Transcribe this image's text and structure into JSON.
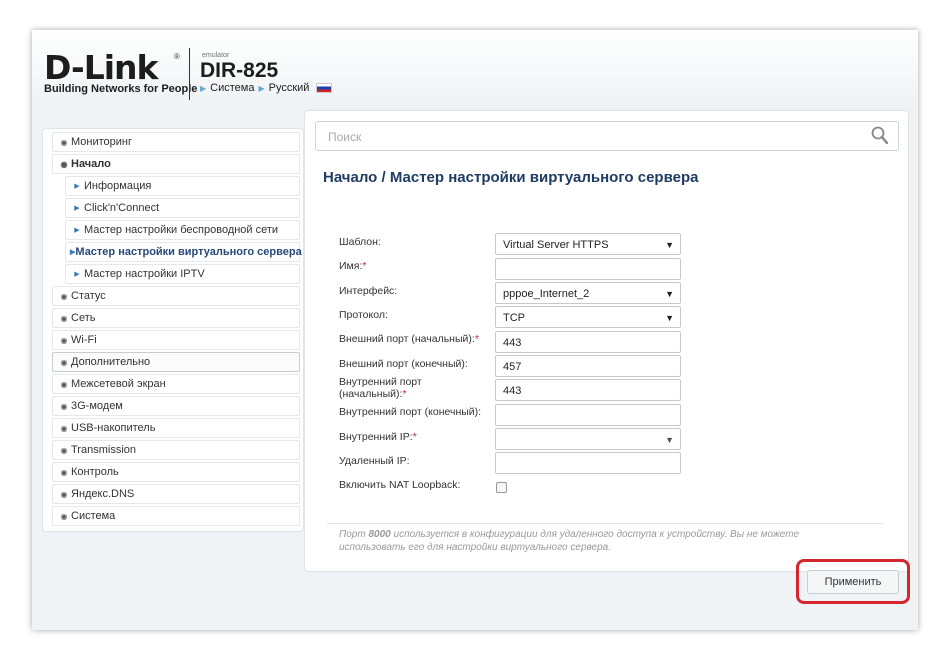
{
  "header": {
    "logo_text": "D-Link",
    "logo_reg": "®",
    "logo_tagline": "Building Networks for People",
    "emulator_label": "emulator",
    "model": "DIR-825",
    "crumb_system": "Система",
    "crumb_language": "Русский"
  },
  "sidebar": {
    "items": [
      {
        "label": "Мониторинг"
      },
      {
        "label": "Начало"
      },
      {
        "label": "Информация"
      },
      {
        "label": "Click'n'Connect"
      },
      {
        "label": "Мастер настройки беспроводной сети"
      },
      {
        "label": "Мастер настройки виртуального сервера"
      },
      {
        "label": "Мастер настройки IPTV"
      },
      {
        "label": "Статус"
      },
      {
        "label": "Сеть"
      },
      {
        "label": "Wi-Fi"
      },
      {
        "label": "Дополнительно"
      },
      {
        "label": "Межсетевой экран"
      },
      {
        "label": "3G-модем"
      },
      {
        "label": "USB-накопитель"
      },
      {
        "label": "Transmission"
      },
      {
        "label": "Контроль"
      },
      {
        "label": "Яндекс.DNS"
      },
      {
        "label": "Система"
      }
    ]
  },
  "search": {
    "placeholder": "Поиск"
  },
  "page": {
    "title": "Начало /  Мастер настройки виртуального сервера"
  },
  "form": {
    "template_label": "Шаблон:",
    "template_value": "Virtual Server HTTPS",
    "name_label": "Имя:",
    "name_value": "",
    "interface_label": "Интерфейс:",
    "interface_value": "pppoe_Internet_2",
    "protocol_label": "Протокол:",
    "protocol_value": "TCP",
    "ext_port_start_label": "Внешний порт (начальный):",
    "ext_port_start_value": "443",
    "ext_port_end_label": "Внешний порт (конечный):",
    "ext_port_end_value": "457",
    "int_port_start_label_1": "Внутренний порт",
    "int_port_start_label_2": "(начальный):",
    "int_port_start_value": "443",
    "int_port_end_label": "Внутренний порт (конечный):",
    "int_port_end_value": "",
    "int_ip_label": "Внутренний IP:",
    "int_ip_value": "",
    "remote_ip_label": "Удаленный IP:",
    "remote_ip_value": "",
    "nat_loopback_label": "Включить NAT Loopback:",
    "nat_loopback_checked": false,
    "required_mark": "*"
  },
  "note": {
    "part1": "Порт ",
    "port": "8000",
    "part2": " используется в конфигурации для удаленного доступа к устройству. Вы не можете использовать его для настройки виртуального сервера."
  },
  "apply_label": "Применить",
  "colors": {
    "accent_highlight": "#d4272d",
    "title": "#1f3c64"
  }
}
